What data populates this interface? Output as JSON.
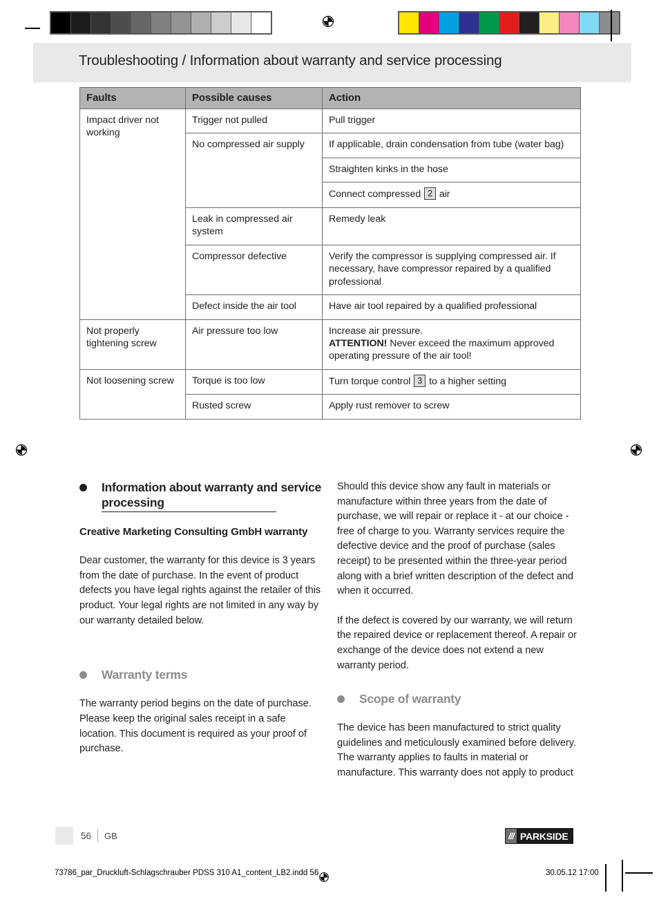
{
  "print_marks": {
    "step_wedge": [
      "#000000",
      "#1c1c1c",
      "#333333",
      "#4d4d4d",
      "#666666",
      "#808080",
      "#949494",
      "#b0b0b0",
      "#cccccc",
      "#e8e8e8",
      "#ffffff"
    ],
    "color_bar": [
      "#ffe600",
      "#e5007e",
      "#00a0e3",
      "#2e3192",
      "#009949",
      "#e31d1a",
      "#231f20",
      "#faee85",
      "#f286bd",
      "#82d9f5",
      "#8c8c8c"
    ],
    "registration_icon": "registration-target-icon"
  },
  "header": {
    "title": "Troubleshooting / Information about warranty and service processing"
  },
  "table": {
    "columns": [
      "Faults",
      "Possible causes",
      "Action"
    ],
    "rows": [
      {
        "fault": "Impact driver not working",
        "causes": [
          {
            "cause": "Trigger not pulled",
            "actions": [
              {
                "text_before": "Pull trigger",
                "box": null,
                "text_after": "",
                "bold_prefix": ""
              }
            ]
          },
          {
            "cause": "No compressed air supply",
            "actions": [
              {
                "text_before": "If applicable, drain condensation from tube (water bag)",
                "box": null,
                "text_after": "",
                "bold_prefix": ""
              },
              {
                "text_before": "Straighten kinks in the hose",
                "box": null,
                "text_after": "",
                "bold_prefix": ""
              },
              {
                "text_before": "Connect compressed ",
                "box": "2",
                "text_after": " air",
                "bold_prefix": ""
              }
            ]
          },
          {
            "cause": "Leak in compressed air system",
            "actions": [
              {
                "text_before": "Remedy leak",
                "box": null,
                "text_after": "",
                "bold_prefix": ""
              }
            ]
          },
          {
            "cause": "Compressor defective",
            "actions": [
              {
                "text_before": "Verify the compressor is supplying compressed air. If necessary, have compressor repaired by a qualified professional",
                "box": null,
                "text_after": "",
                "bold_prefix": ""
              }
            ]
          },
          {
            "cause": "Defect inside the air tool",
            "actions": [
              {
                "text_before": "Have air tool repaired by a qualified professional",
                "box": null,
                "text_after": "",
                "bold_prefix": ""
              }
            ]
          }
        ]
      },
      {
        "fault": "Not properly tightening screw",
        "causes": [
          {
            "cause": "Air pressure too low",
            "actions": [
              {
                "line1": "Increase air pressure.",
                "bold_prefix": "ATTENTION!",
                "text_before": " Never exceed the maximum approved operating pressure of the air tool!",
                "box": null,
                "text_after": ""
              }
            ]
          }
        ]
      },
      {
        "fault": "Not loosening screw",
        "causes": [
          {
            "cause": "Torque is too low",
            "actions": [
              {
                "text_before": "Turn torque control ",
                "box": "3",
                "text_after": " to a higher setting",
                "bold_prefix": ""
              }
            ]
          },
          {
            "cause": "Rusted screw",
            "actions": [
              {
                "text_before": "Apply rust remover to screw",
                "box": null,
                "text_after": "",
                "bold_prefix": ""
              }
            ]
          }
        ]
      }
    ]
  },
  "left_column": {
    "heading1": "Information about warranty and service processing",
    "subheading1": "Creative Marketing Consulting GmbH warranty",
    "para1": "Dear customer, the warranty for this device is 3 years from the date of purchase. In the event of product defects you have legal rights against the retailer of this product. Your legal rights are not limited in any way by our warranty detailed below.",
    "heading2": "Warranty terms",
    "para2": "The warranty period begins on the date of purchase. Please keep the original sales receipt in a safe location. This document is required as your proof of purchase."
  },
  "right_column": {
    "para1": "Should this device show any fault in materials or manufacture within three years from the date of purchase, we will repair or replace it - at our choice - free of charge to you. Warranty services require the defective device and the proof of purchase (sales receipt) to be presented within the three-year period along with a brief written description of the defect and when it occurred.",
    "para2": "If the defect is covered by our warranty, we will return the repaired device or replacement thereof. A repair or exchange of the device does not extend a new warranty period.",
    "heading1": "Scope of warranty",
    "para3": "The device has been manufactured to strict quality guidelines and meticulously examined before delivery. The warranty applies to faults in material or manufacture. This warranty does not apply to product"
  },
  "footer": {
    "page_number": "56",
    "language": "GB",
    "logo_slashes": "///",
    "logo_name": "PARKSIDE"
  },
  "imposition": {
    "file_name": "73786_par_Druckluft-Schlagschrauber PDSS 310 A1_content_LB2.indd   56",
    "date_time": "30.05.12   17:00"
  }
}
